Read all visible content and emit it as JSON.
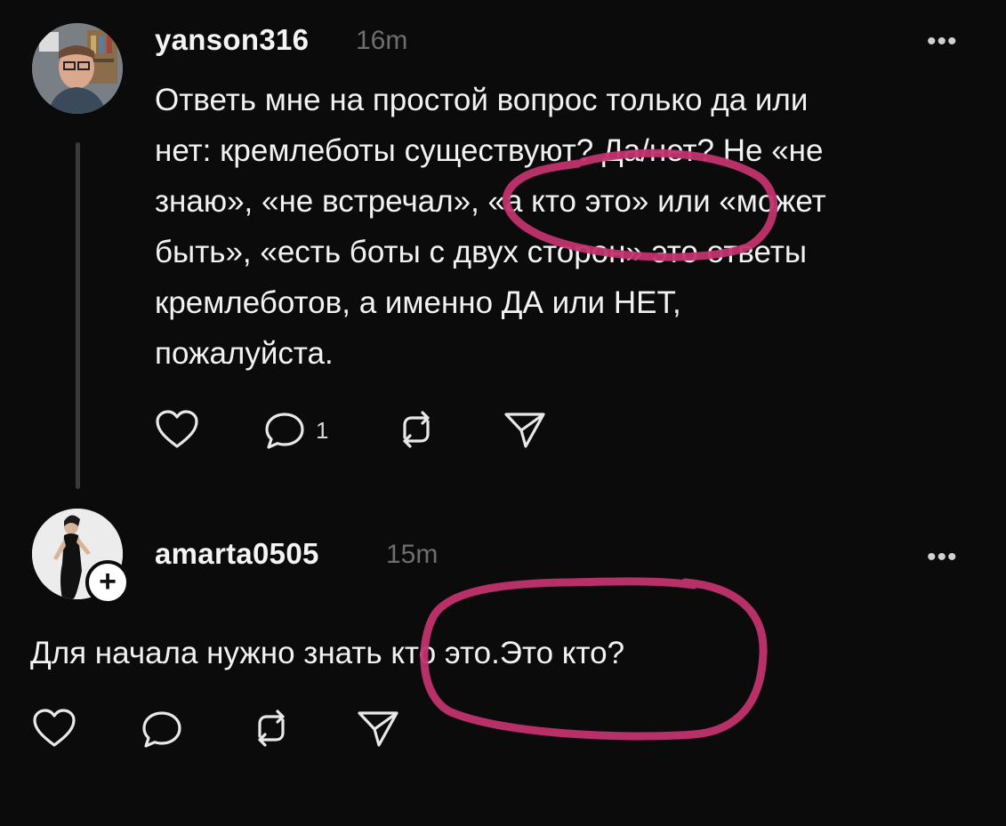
{
  "post1": {
    "username": "yanson316",
    "time": "16m",
    "more": "•••",
    "text_lines": [
      "Ответь мне на простой вопрос только да или",
      "нет: кремлеботы существуют? Да/нет?  Не «не",
      "знаю», «не встречал», «а кто это» или «может",
      "быть», «есть боты с двух сторон» это ответы",
      "кремлеботов, а именно ДА или НЕТ,",
      "пожалуйста."
    ],
    "reply_count": "1"
  },
  "post2": {
    "username": "amarta0505",
    "time": "15m",
    "more": "•••",
    "text": "Для начала нужно знать кто это.Это кто?",
    "follow_badge": "+"
  },
  "icons": {
    "like": "heart-icon",
    "reply": "comment-icon",
    "repost": "repost-icon",
    "share": "share-icon",
    "more": "more-icon"
  },
  "colors": {
    "background": "#0b0b0b",
    "text": "#f2f2f2",
    "muted": "#6e6e6e",
    "annotation": "#c2336e"
  }
}
